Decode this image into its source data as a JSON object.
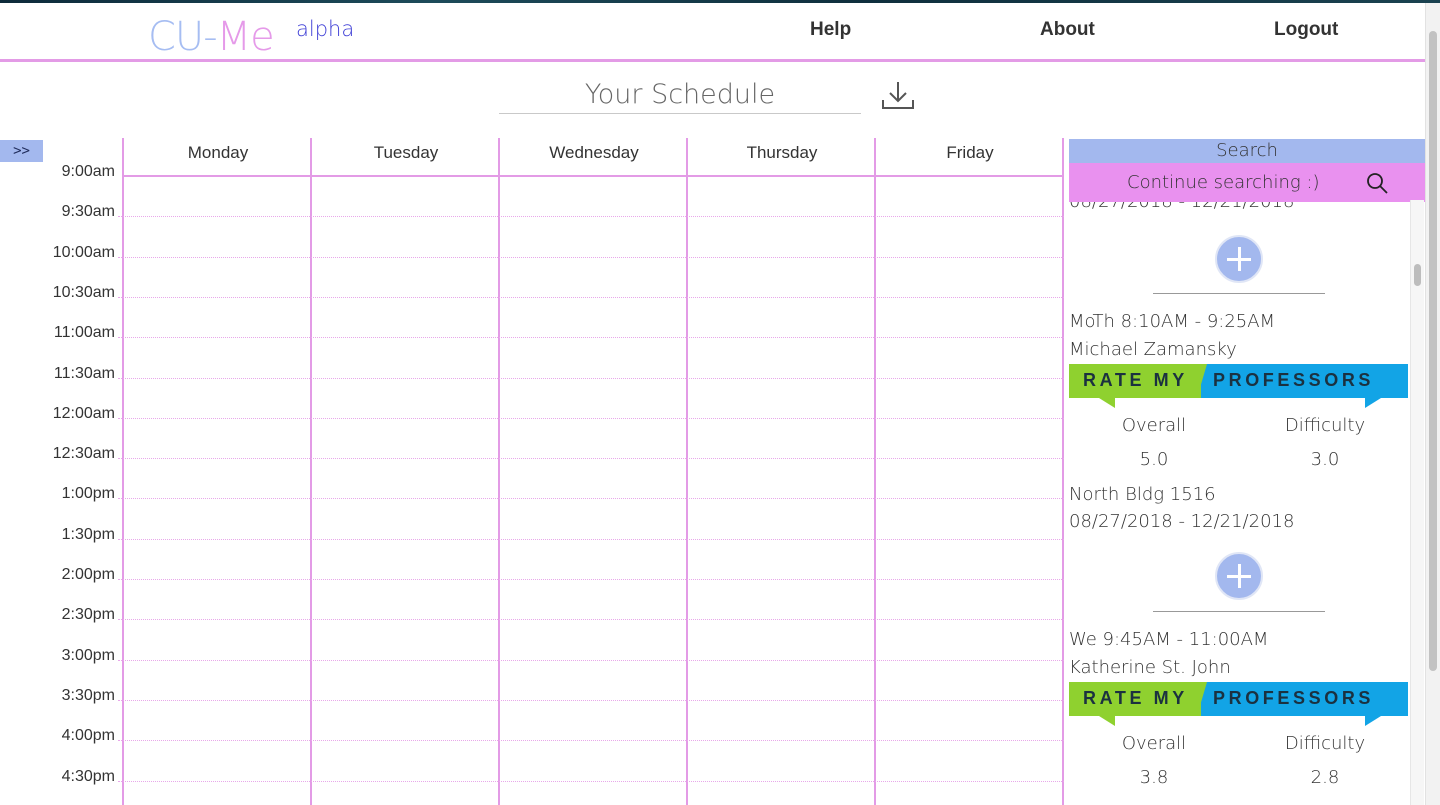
{
  "app": {
    "logo_main": "CU-",
    "logo_me": "Me",
    "logo_super": "alpha"
  },
  "nav": {
    "help": "Help",
    "about": "About",
    "logout": "Logout"
  },
  "schedule": {
    "title": "Your Schedule",
    "toggle_label": ">>",
    "days": [
      "Monday",
      "Tuesday",
      "Wednesday",
      "Thursday",
      "Friday"
    ],
    "times": [
      "9:00am",
      "9:30am",
      "10:00am",
      "10:30am",
      "11:00am",
      "11:30am",
      "12:00am",
      "12:30am",
      "1:00pm",
      "1:30pm",
      "2:00pm",
      "2:30pm",
      "3:00pm",
      "3:30pm",
      "4:00pm",
      "4:30pm"
    ]
  },
  "panel": {
    "search_label": "Search",
    "continue_label": "Continue searching :)",
    "partial_dates": "08/27/2018 - 12/21/2018",
    "sections": [
      {
        "time": "MoTh 8:10AM - 9:25AM",
        "professor": "Michael Zamansky",
        "rmp_left": "RATE MY",
        "rmp_right": "PROFESSORS",
        "overall_label": "Overall",
        "difficulty_label": "Difficulty",
        "overall": "5.0",
        "difficulty": "3.0",
        "location": "North Bldg 1516",
        "dates": "08/27/2018 - 12/21/2018"
      },
      {
        "time": "We 9:45AM - 11:00AM",
        "professor": "Katherine St. John",
        "rmp_left": "RATE MY",
        "rmp_right": "PROFESSORS",
        "overall_label": "Overall",
        "difficulty_label": "Difficulty",
        "overall": "3.8",
        "difficulty": "2.8"
      }
    ]
  },
  "colors": {
    "accent_pink": "#e39be6",
    "accent_blue": "#a3b8ee",
    "rmp_green": "#8fd12f",
    "rmp_blue": "#12a4e6"
  }
}
